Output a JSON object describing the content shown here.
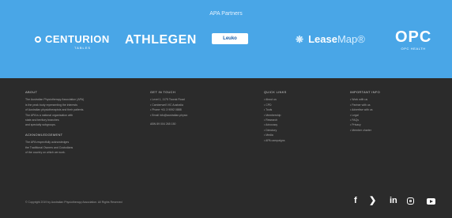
{
  "partners": {
    "title": "APA Partners",
    "logos": {
      "centurion": "CENTURION",
      "centurion_sub": "TABLES",
      "athlegen": "ATHLEGEN",
      "leuko": "Leuko",
      "leasemap_bold": "Lease",
      "leasemap_thin": "Map®",
      "opc": "OPC",
      "opc_sub": "OPC HEALTH"
    }
  },
  "footer": {
    "about": {
      "heading": "ABOUT",
      "lines": [
        "The Australian Physiotherapy Association (APA)",
        "is the peak body representing the interests",
        "of Australian physiotherapists and their patients.",
        "The APA is a national organisation with",
        "state and territory branches",
        "and specialty subgroups."
      ]
    },
    "acknowledgement": {
      "heading": "ACKNOWLEDGEMENT",
      "lines": [
        "The APA respectfully acknowledges",
        "the Traditional Owners and Custodians",
        "of the country on which we work."
      ]
    },
    "touch": {
      "heading": "GET IN TOUCH",
      "lines": [
        "• Level 1, 1175 Toorak Road",
        "• Camberwell VIC Australia",
        "• Phone +61 3 9092 0888",
        "• Email info@australian.physio"
      ],
      "abn": "ABN 89 004 265 150"
    },
    "quick_links": {
      "heading": "QUICK LINKS",
      "items": [
        "• About us",
        "• CPD",
        "• Tools",
        "• Membership",
        "• Research",
        "• Advocacy",
        "• Directory",
        "• Media",
        "• APA campaigns"
      ]
    },
    "important_info": {
      "heading": "IMPORTANT INFO",
      "items": [
        "• Work with us",
        "• Partner with us",
        "• Advertise with us",
        "• Legal",
        "• FAQs",
        "• Privacy",
        "• Member charter"
      ]
    },
    "copyright": "© Copyright 2019 by Australian Physiotherapy Association. All Rights Reserved",
    "social": {
      "facebook": "f",
      "twitter": "❯",
      "linkedin": "in"
    }
  },
  "icons": [
    "centurion-c-icon",
    "leasemap-flower-icon",
    "facebook-icon",
    "twitter-icon",
    "linkedin-icon",
    "instagram-icon",
    "youtube-icon"
  ],
  "colors": {
    "partners_bg": "#49a6e7",
    "footer_bg": "#2b2b2b"
  }
}
